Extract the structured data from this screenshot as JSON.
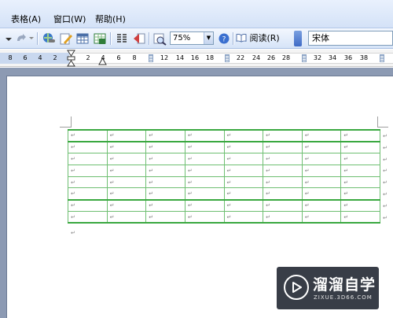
{
  "menu": {
    "items": [
      "表格(A)",
      "窗口(W)",
      "帮助(H)"
    ]
  },
  "toolbar": {
    "zoom_value": "75%",
    "read_label": "阅读(R)",
    "font_name": "宋体",
    "icons": [
      "undo-dropdown-icon",
      "redo-icon",
      "hyperlink-icon",
      "drawing-icon",
      "table-icon",
      "excel-icon",
      "columns-icon",
      "document-map-icon",
      "zoom-icon",
      "help-icon",
      "read-icon"
    ]
  },
  "ruler": {
    "labels": [
      "8",
      "6",
      "4",
      "2",
      "2",
      "4",
      "6",
      "8",
      "12",
      "14",
      "16",
      "18",
      "22",
      "24",
      "26",
      "28",
      "32",
      "34",
      "36",
      "38"
    ]
  },
  "table": {
    "rows": 8,
    "columns": 8,
    "cell_mark": "↵",
    "row_end_mark": "↵"
  },
  "paragraph_mark": "↵",
  "watermark": {
    "title": "溜溜自学",
    "subtitle": "ZIXUE.3D66.COM"
  },
  "colors": {
    "table_border": "#3aa840",
    "menubar": "#d4e2f7",
    "workspace": "#8c9ab3"
  }
}
